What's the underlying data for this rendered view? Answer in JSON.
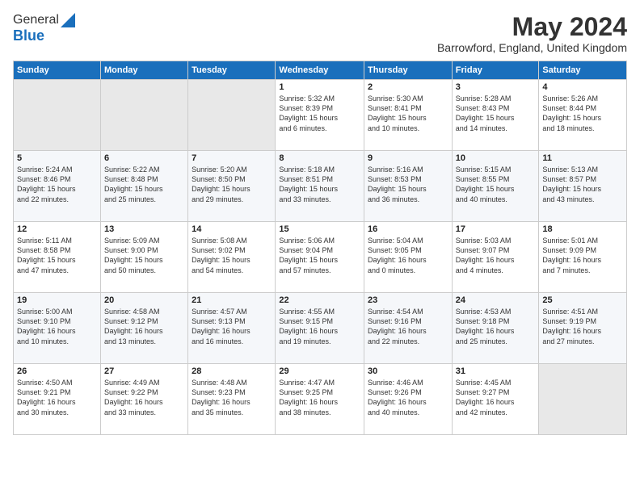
{
  "logo": {
    "general": "General",
    "blue": "Blue"
  },
  "title": "May 2024",
  "location": "Barrowford, England, United Kingdom",
  "days_of_week": [
    "Sunday",
    "Monday",
    "Tuesday",
    "Wednesday",
    "Thursday",
    "Friday",
    "Saturday"
  ],
  "weeks": [
    [
      {
        "day": "",
        "info": ""
      },
      {
        "day": "",
        "info": ""
      },
      {
        "day": "",
        "info": ""
      },
      {
        "day": "1",
        "info": "Sunrise: 5:32 AM\nSunset: 8:39 PM\nDaylight: 15 hours\nand 6 minutes."
      },
      {
        "day": "2",
        "info": "Sunrise: 5:30 AM\nSunset: 8:41 PM\nDaylight: 15 hours\nand 10 minutes."
      },
      {
        "day": "3",
        "info": "Sunrise: 5:28 AM\nSunset: 8:43 PM\nDaylight: 15 hours\nand 14 minutes."
      },
      {
        "day": "4",
        "info": "Sunrise: 5:26 AM\nSunset: 8:44 PM\nDaylight: 15 hours\nand 18 minutes."
      }
    ],
    [
      {
        "day": "5",
        "info": "Sunrise: 5:24 AM\nSunset: 8:46 PM\nDaylight: 15 hours\nand 22 minutes."
      },
      {
        "day": "6",
        "info": "Sunrise: 5:22 AM\nSunset: 8:48 PM\nDaylight: 15 hours\nand 25 minutes."
      },
      {
        "day": "7",
        "info": "Sunrise: 5:20 AM\nSunset: 8:50 PM\nDaylight: 15 hours\nand 29 minutes."
      },
      {
        "day": "8",
        "info": "Sunrise: 5:18 AM\nSunset: 8:51 PM\nDaylight: 15 hours\nand 33 minutes."
      },
      {
        "day": "9",
        "info": "Sunrise: 5:16 AM\nSunset: 8:53 PM\nDaylight: 15 hours\nand 36 minutes."
      },
      {
        "day": "10",
        "info": "Sunrise: 5:15 AM\nSunset: 8:55 PM\nDaylight: 15 hours\nand 40 minutes."
      },
      {
        "day": "11",
        "info": "Sunrise: 5:13 AM\nSunset: 8:57 PM\nDaylight: 15 hours\nand 43 minutes."
      }
    ],
    [
      {
        "day": "12",
        "info": "Sunrise: 5:11 AM\nSunset: 8:58 PM\nDaylight: 15 hours\nand 47 minutes."
      },
      {
        "day": "13",
        "info": "Sunrise: 5:09 AM\nSunset: 9:00 PM\nDaylight: 15 hours\nand 50 minutes."
      },
      {
        "day": "14",
        "info": "Sunrise: 5:08 AM\nSunset: 9:02 PM\nDaylight: 15 hours\nand 54 minutes."
      },
      {
        "day": "15",
        "info": "Sunrise: 5:06 AM\nSunset: 9:04 PM\nDaylight: 15 hours\nand 57 minutes."
      },
      {
        "day": "16",
        "info": "Sunrise: 5:04 AM\nSunset: 9:05 PM\nDaylight: 16 hours\nand 0 minutes."
      },
      {
        "day": "17",
        "info": "Sunrise: 5:03 AM\nSunset: 9:07 PM\nDaylight: 16 hours\nand 4 minutes."
      },
      {
        "day": "18",
        "info": "Sunrise: 5:01 AM\nSunset: 9:09 PM\nDaylight: 16 hours\nand 7 minutes."
      }
    ],
    [
      {
        "day": "19",
        "info": "Sunrise: 5:00 AM\nSunset: 9:10 PM\nDaylight: 16 hours\nand 10 minutes."
      },
      {
        "day": "20",
        "info": "Sunrise: 4:58 AM\nSunset: 9:12 PM\nDaylight: 16 hours\nand 13 minutes."
      },
      {
        "day": "21",
        "info": "Sunrise: 4:57 AM\nSunset: 9:13 PM\nDaylight: 16 hours\nand 16 minutes."
      },
      {
        "day": "22",
        "info": "Sunrise: 4:55 AM\nSunset: 9:15 PM\nDaylight: 16 hours\nand 19 minutes."
      },
      {
        "day": "23",
        "info": "Sunrise: 4:54 AM\nSunset: 9:16 PM\nDaylight: 16 hours\nand 22 minutes."
      },
      {
        "day": "24",
        "info": "Sunrise: 4:53 AM\nSunset: 9:18 PM\nDaylight: 16 hours\nand 25 minutes."
      },
      {
        "day": "25",
        "info": "Sunrise: 4:51 AM\nSunset: 9:19 PM\nDaylight: 16 hours\nand 27 minutes."
      }
    ],
    [
      {
        "day": "26",
        "info": "Sunrise: 4:50 AM\nSunset: 9:21 PM\nDaylight: 16 hours\nand 30 minutes."
      },
      {
        "day": "27",
        "info": "Sunrise: 4:49 AM\nSunset: 9:22 PM\nDaylight: 16 hours\nand 33 minutes."
      },
      {
        "day": "28",
        "info": "Sunrise: 4:48 AM\nSunset: 9:23 PM\nDaylight: 16 hours\nand 35 minutes."
      },
      {
        "day": "29",
        "info": "Sunrise: 4:47 AM\nSunset: 9:25 PM\nDaylight: 16 hours\nand 38 minutes."
      },
      {
        "day": "30",
        "info": "Sunrise: 4:46 AM\nSunset: 9:26 PM\nDaylight: 16 hours\nand 40 minutes."
      },
      {
        "day": "31",
        "info": "Sunrise: 4:45 AM\nSunset: 9:27 PM\nDaylight: 16 hours\nand 42 minutes."
      },
      {
        "day": "",
        "info": ""
      }
    ]
  ],
  "colors": {
    "header_bg": "#1a6fbc",
    "header_text": "#ffffff",
    "title_color": "#333333",
    "empty_cell": "#e8e8e8"
  }
}
